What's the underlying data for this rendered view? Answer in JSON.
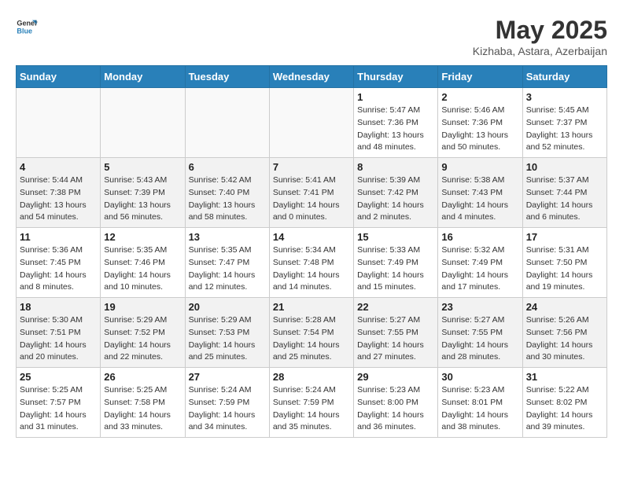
{
  "header": {
    "logo_line1": "General",
    "logo_line2": "Blue",
    "month_year": "May 2025",
    "location": "Kizhaba, Astara, Azerbaijan"
  },
  "weekdays": [
    "Sunday",
    "Monday",
    "Tuesday",
    "Wednesday",
    "Thursday",
    "Friday",
    "Saturday"
  ],
  "weeks": [
    [
      {
        "day": "",
        "detail": ""
      },
      {
        "day": "",
        "detail": ""
      },
      {
        "day": "",
        "detail": ""
      },
      {
        "day": "",
        "detail": ""
      },
      {
        "day": "1",
        "detail": "Sunrise: 5:47 AM\nSunset: 7:36 PM\nDaylight: 13 hours\nand 48 minutes."
      },
      {
        "day": "2",
        "detail": "Sunrise: 5:46 AM\nSunset: 7:36 PM\nDaylight: 13 hours\nand 50 minutes."
      },
      {
        "day": "3",
        "detail": "Sunrise: 5:45 AM\nSunset: 7:37 PM\nDaylight: 13 hours\nand 52 minutes."
      }
    ],
    [
      {
        "day": "4",
        "detail": "Sunrise: 5:44 AM\nSunset: 7:38 PM\nDaylight: 13 hours\nand 54 minutes."
      },
      {
        "day": "5",
        "detail": "Sunrise: 5:43 AM\nSunset: 7:39 PM\nDaylight: 13 hours\nand 56 minutes."
      },
      {
        "day": "6",
        "detail": "Sunrise: 5:42 AM\nSunset: 7:40 PM\nDaylight: 13 hours\nand 58 minutes."
      },
      {
        "day": "7",
        "detail": "Sunrise: 5:41 AM\nSunset: 7:41 PM\nDaylight: 14 hours\nand 0 minutes."
      },
      {
        "day": "8",
        "detail": "Sunrise: 5:39 AM\nSunset: 7:42 PM\nDaylight: 14 hours\nand 2 minutes."
      },
      {
        "day": "9",
        "detail": "Sunrise: 5:38 AM\nSunset: 7:43 PM\nDaylight: 14 hours\nand 4 minutes."
      },
      {
        "day": "10",
        "detail": "Sunrise: 5:37 AM\nSunset: 7:44 PM\nDaylight: 14 hours\nand 6 minutes."
      }
    ],
    [
      {
        "day": "11",
        "detail": "Sunrise: 5:36 AM\nSunset: 7:45 PM\nDaylight: 14 hours\nand 8 minutes."
      },
      {
        "day": "12",
        "detail": "Sunrise: 5:35 AM\nSunset: 7:46 PM\nDaylight: 14 hours\nand 10 minutes."
      },
      {
        "day": "13",
        "detail": "Sunrise: 5:35 AM\nSunset: 7:47 PM\nDaylight: 14 hours\nand 12 minutes."
      },
      {
        "day": "14",
        "detail": "Sunrise: 5:34 AM\nSunset: 7:48 PM\nDaylight: 14 hours\nand 14 minutes."
      },
      {
        "day": "15",
        "detail": "Sunrise: 5:33 AM\nSunset: 7:49 PM\nDaylight: 14 hours\nand 15 minutes."
      },
      {
        "day": "16",
        "detail": "Sunrise: 5:32 AM\nSunset: 7:49 PM\nDaylight: 14 hours\nand 17 minutes."
      },
      {
        "day": "17",
        "detail": "Sunrise: 5:31 AM\nSunset: 7:50 PM\nDaylight: 14 hours\nand 19 minutes."
      }
    ],
    [
      {
        "day": "18",
        "detail": "Sunrise: 5:30 AM\nSunset: 7:51 PM\nDaylight: 14 hours\nand 20 minutes."
      },
      {
        "day": "19",
        "detail": "Sunrise: 5:29 AM\nSunset: 7:52 PM\nDaylight: 14 hours\nand 22 minutes."
      },
      {
        "day": "20",
        "detail": "Sunrise: 5:29 AM\nSunset: 7:53 PM\nDaylight: 14 hours\nand 25 minutes."
      },
      {
        "day": "21",
        "detail": "Sunrise: 5:28 AM\nSunset: 7:54 PM\nDaylight: 14 hours\nand 25 minutes."
      },
      {
        "day": "22",
        "detail": "Sunrise: 5:27 AM\nSunset: 7:55 PM\nDaylight: 14 hours\nand 27 minutes."
      },
      {
        "day": "23",
        "detail": "Sunrise: 5:27 AM\nSunset: 7:55 PM\nDaylight: 14 hours\nand 28 minutes."
      },
      {
        "day": "24",
        "detail": "Sunrise: 5:26 AM\nSunset: 7:56 PM\nDaylight: 14 hours\nand 30 minutes."
      }
    ],
    [
      {
        "day": "25",
        "detail": "Sunrise: 5:25 AM\nSunset: 7:57 PM\nDaylight: 14 hours\nand 31 minutes."
      },
      {
        "day": "26",
        "detail": "Sunrise: 5:25 AM\nSunset: 7:58 PM\nDaylight: 14 hours\nand 33 minutes."
      },
      {
        "day": "27",
        "detail": "Sunrise: 5:24 AM\nSunset: 7:59 PM\nDaylight: 14 hours\nand 34 minutes."
      },
      {
        "day": "28",
        "detail": "Sunrise: 5:24 AM\nSunset: 7:59 PM\nDaylight: 14 hours\nand 35 minutes."
      },
      {
        "day": "29",
        "detail": "Sunrise: 5:23 AM\nSunset: 8:00 PM\nDaylight: 14 hours\nand 36 minutes."
      },
      {
        "day": "30",
        "detail": "Sunrise: 5:23 AM\nSunset: 8:01 PM\nDaylight: 14 hours\nand 38 minutes."
      },
      {
        "day": "31",
        "detail": "Sunrise: 5:22 AM\nSunset: 8:02 PM\nDaylight: 14 hours\nand 39 minutes."
      }
    ]
  ]
}
